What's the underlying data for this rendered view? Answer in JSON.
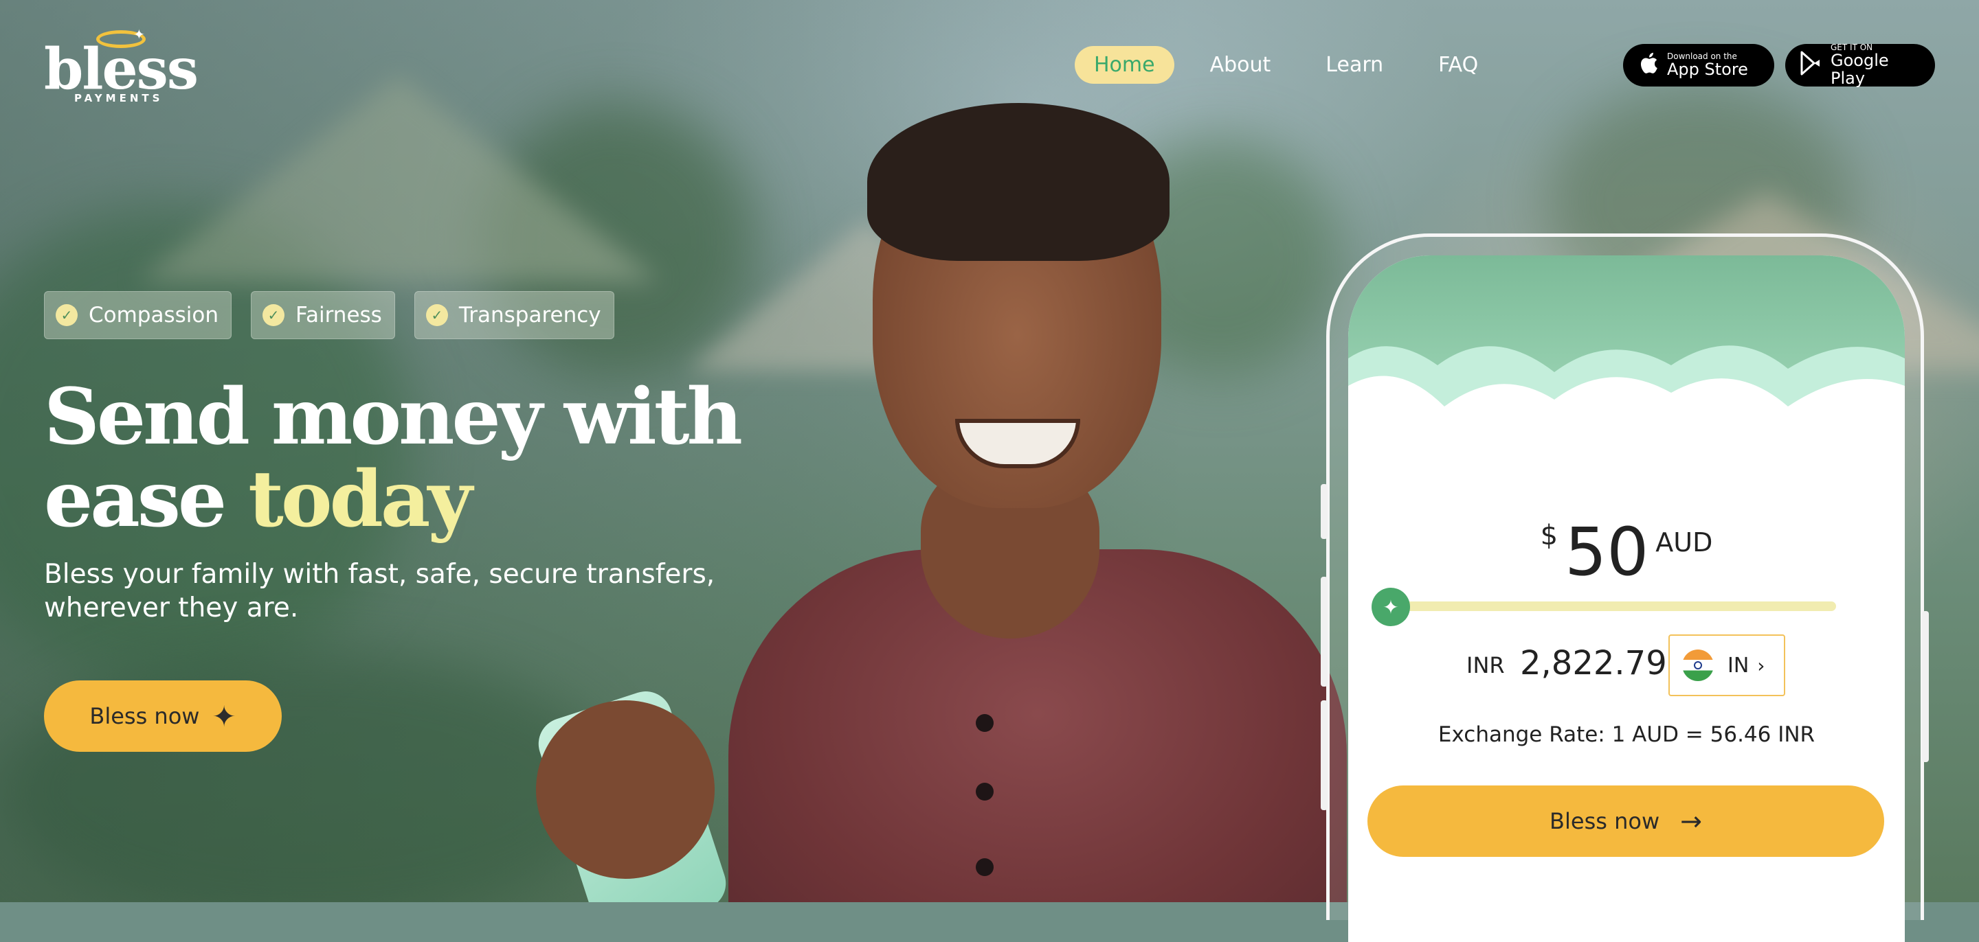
{
  "brand": {
    "name": "bless",
    "subname": "PAYMENTS"
  },
  "nav": {
    "items": [
      {
        "label": "Home",
        "active": true
      },
      {
        "label": "About",
        "active": false
      },
      {
        "label": "Learn",
        "active": false
      },
      {
        "label": "FAQ",
        "active": false
      }
    ]
  },
  "stores": {
    "apple": {
      "small": "Download on the",
      "big": "App Store",
      "icon": "apple-icon"
    },
    "google": {
      "small": "GET IT ON",
      "big": "Google Play",
      "icon": "google-play-icon"
    }
  },
  "hero": {
    "tags": [
      "Compassion",
      "Fairness",
      "Transparency"
    ],
    "headline_line1": "Send money with",
    "headline_line2_plain": "ease",
    "headline_line2_highlight": "today",
    "subtitle": "Bless your family with fast, safe, secure transfers, wherever they are.",
    "cta_label": "Bless now"
  },
  "calculator": {
    "currency_symbol": "$",
    "amount": "50",
    "amount_currency": "AUD",
    "receive_currency": "INR",
    "receive_amount": "2,822.79",
    "country_code": "IN",
    "exchange_rate_text": "Exchange Rate: 1 AUD = 56.46 INR",
    "cta_label": "Bless now"
  },
  "colors": {
    "accent_yellow": "#f5b93e",
    "highlight_text": "#f4ef9e",
    "nav_active_bg": "#f7e39a",
    "nav_active_text": "#3aa96b",
    "green": "#49a86a"
  }
}
